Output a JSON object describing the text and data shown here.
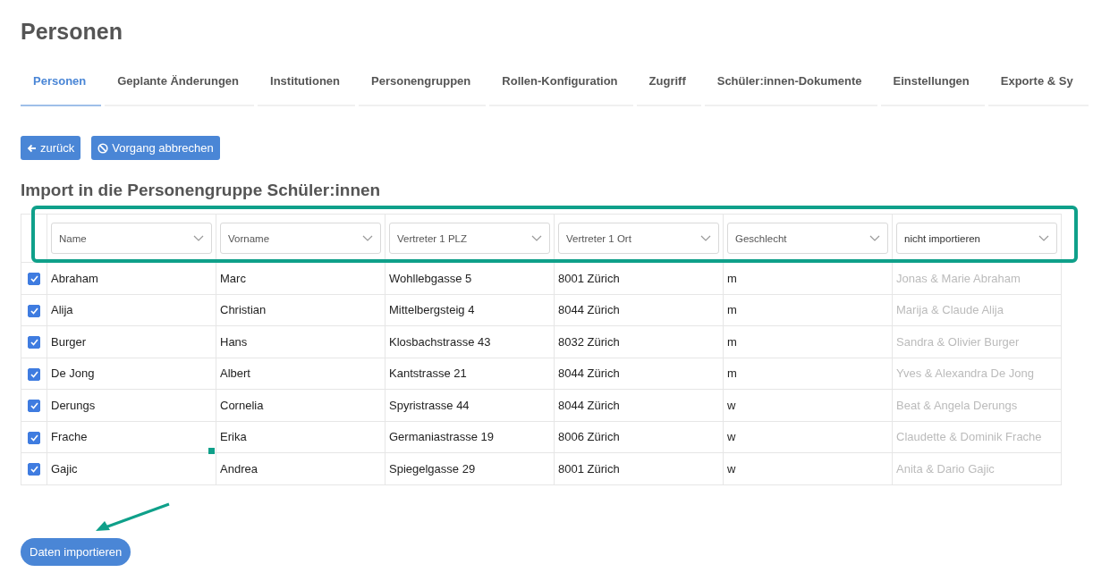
{
  "page_title": "Personen",
  "tabs": [
    {
      "label": "Personen",
      "selected": true
    },
    {
      "label": "Geplante Änderungen",
      "selected": false
    },
    {
      "label": "Institutionen",
      "selected": false
    },
    {
      "label": "Personengruppen",
      "selected": false
    },
    {
      "label": "Rollen-Konfiguration",
      "selected": false
    },
    {
      "label": "Zugriff",
      "selected": false
    },
    {
      "label": "Schüler:innen-Dokumente",
      "selected": false
    },
    {
      "label": "Einstellungen",
      "selected": false
    },
    {
      "label": "Exporte & Sy",
      "selected": false
    }
  ],
  "actions": [
    {
      "label": "zurück",
      "kind": "back"
    },
    {
      "label": "Vorgang abbrechen",
      "kind": "cancel"
    }
  ],
  "heading": "Import in die Personengruppe Schüler:innen",
  "columns": [
    {
      "mapping": "Name",
      "imported": true
    },
    {
      "mapping": "Vorname",
      "imported": true
    },
    {
      "mapping": "Vertreter 1 PLZ",
      "imported": true
    },
    {
      "mapping": "Vertreter 1 Ort",
      "imported": true
    },
    {
      "mapping": "Geschlecht",
      "imported": true
    },
    {
      "mapping": "nicht importieren",
      "imported": false
    }
  ],
  "rows": [
    {
      "checked": true,
      "cells": [
        "Abraham",
        "Marc",
        "Wohllebgasse 5",
        "8001 Zürich",
        "m",
        "Jonas & Marie Abraham"
      ]
    },
    {
      "checked": true,
      "cells": [
        "Alija",
        "Christian",
        "Mittelbergsteig 4",
        "8044 Zürich",
        "m",
        "Marija & Claude Alija"
      ]
    },
    {
      "checked": true,
      "cells": [
        "Burger",
        "Hans",
        "Klosbachstrasse 43",
        "8032 Zürich",
        "m",
        "Sandra & Olivier Burger"
      ]
    },
    {
      "checked": true,
      "cells": [
        "De Jong",
        "Albert",
        "Kantstrasse 21",
        "8044 Zürich",
        "m",
        "Yves & Alexandra De Jong"
      ]
    },
    {
      "checked": true,
      "cells": [
        "Derungs",
        "Cornelia",
        "Spyristrasse 44",
        "8044 Zürich",
        "w",
        "Beat & Angela Derungs"
      ]
    },
    {
      "checked": true,
      "cells": [
        "Frache",
        "Erika",
        "Germaniastrasse 19",
        "8006 Zürich",
        "w",
        "Claudette & Dominik Frache"
      ]
    },
    {
      "checked": true,
      "cells": [
        "Gajic",
        "Andrea",
        "Spiegelgasse 29",
        "8001 Zürich",
        "w",
        "Anita & Dario Gajic"
      ]
    }
  ],
  "submit": "Daten importieren"
}
